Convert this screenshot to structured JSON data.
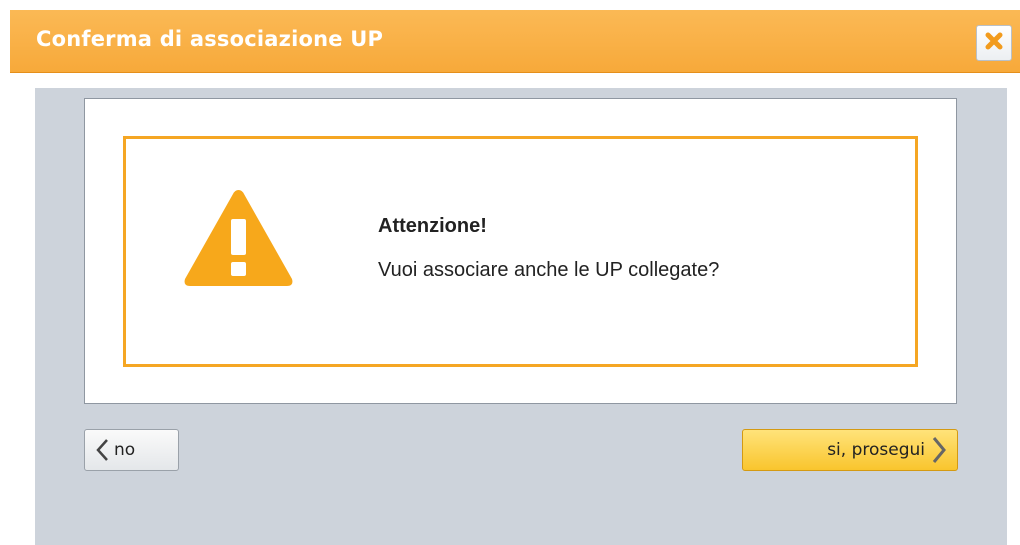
{
  "dialog": {
    "title": "Conferma di associazione UP",
    "close_icon": "close-icon",
    "accent_color": "#f7a93a"
  },
  "alert": {
    "icon": "warning-icon",
    "title": "Attenzione!",
    "message": "Vuoi associare anche le UP collegate?",
    "border_color": "#f5a623"
  },
  "buttons": {
    "no_label": "no",
    "no_icon": "chevron-left-icon",
    "yes_label": "si, prosegui",
    "yes_icon": "chevron-right-icon"
  }
}
